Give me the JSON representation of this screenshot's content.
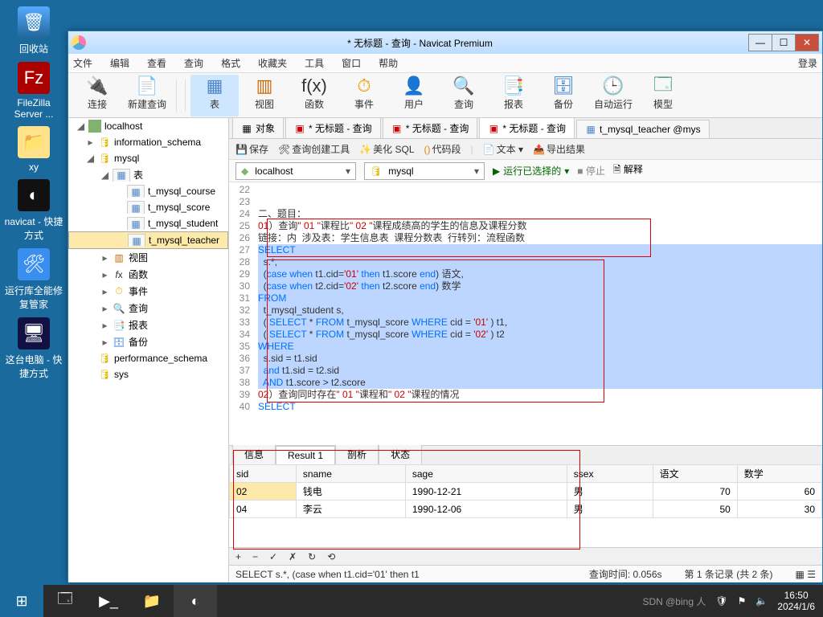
{
  "desktop": {
    "icons": [
      "回收站",
      "FileZilla Server ...",
      "xy",
      "navicat - 快捷方式",
      "运行库全能修复管家",
      "这台电脑 - 快捷方式"
    ]
  },
  "win": {
    "title": "* 无标题 - 查询 - Navicat Premium",
    "menus": [
      "文件",
      "编辑",
      "查看",
      "查询",
      "格式",
      "收藏夹",
      "工具",
      "窗口",
      "帮助"
    ],
    "login": "登录",
    "toolbar": [
      {
        "lbl": "连接",
        "cls": "plug",
        "glyph": "🔌"
      },
      {
        "lbl": "新建查询",
        "cls": "new",
        "glyph": "📄"
      },
      {
        "lbl": "表",
        "cls": "table",
        "glyph": "▦",
        "act": true
      },
      {
        "lbl": "视图",
        "cls": "view",
        "glyph": "▥"
      },
      {
        "lbl": "函数",
        "cls": "fx",
        "glyph": "f(x)"
      },
      {
        "lbl": "事件",
        "cls": "ev",
        "glyph": "⏱"
      },
      {
        "lbl": "用户",
        "cls": "usr",
        "glyph": "👤"
      },
      {
        "lbl": "查询",
        "cls": "find",
        "glyph": "🔍"
      },
      {
        "lbl": "报表",
        "cls": "rep",
        "glyph": "📑"
      },
      {
        "lbl": "备份",
        "cls": "bak",
        "glyph": "🗄"
      },
      {
        "lbl": "自动运行",
        "cls": "auto",
        "glyph": "🕒"
      },
      {
        "lbl": "模型",
        "cls": "model",
        "glyph": "🗔"
      }
    ],
    "tree": {
      "root": "localhost",
      "dbs": [
        "information_schema",
        "mysql"
      ],
      "tables": [
        "t_mysql_course",
        "t_mysql_score",
        "t_mysql_student",
        "t_mysql_teacher"
      ],
      "folders": {
        "table": "表",
        "view": "视图",
        "fx": "函数",
        "event": "事件",
        "query": "查询",
        "report": "报表",
        "backup": "备份"
      },
      "other_dbs": [
        "performance_schema",
        "sys"
      ]
    },
    "tabs": {
      "obj": "对象",
      "t1": "* 无标题 - 查询",
      "t2": "* 无标题 - 查询",
      "t3": "* 无标题 - 查询",
      "t4": "t_mysql_teacher @mys"
    },
    "subbar": {
      "save": "保存",
      "qb": "查询创建工具",
      "beautify": "美化 SQL",
      "cfold": "代码段",
      "text": "文本",
      "export": "导出结果"
    },
    "connbar": {
      "conn": "localhost",
      "db": "mysql",
      "run": "运行已选择的",
      "stop": "停止",
      "explain": "解释"
    },
    "code": {
      "lines": [
        {
          "n": 22,
          "t": ""
        },
        {
          "n": 23,
          "t": ""
        },
        {
          "n": 24,
          "t": "二、题目："
        },
        {
          "n": 25,
          "p": [
            [
              "01",
              "red"
            ],
            [
              "）查询",
              ""
            ],
            [
              "\" 01 \"",
              "str"
            ],
            [
              "课程比",
              ""
            ],
            [
              "\" 02 \"",
              "str"
            ],
            [
              "课程成绩高的学生的信息及课程分数",
              ""
            ]
          ]
        },
        {
          "n": 26,
          "t": "链接：内  涉及表：学生信息表  课程分数表  行转列：流程函数"
        },
        {
          "n": 27,
          "hl": true,
          "p": [
            [
              "SELECT",
              "kw"
            ]
          ]
        },
        {
          "n": 28,
          "hl": true,
          "t": "  s.*,"
        },
        {
          "n": 29,
          "hl": true,
          "p": [
            [
              "  (",
              ""
            ],
            [
              "case when",
              "kw"
            ],
            [
              " t1.cid=",
              ""
            ],
            [
              "'01'",
              "str"
            ],
            [
              " ",
              ""
            ],
            [
              "then",
              "kw"
            ],
            [
              " t1.score ",
              ""
            ],
            [
              "end",
              "kw"
            ],
            [
              ") 语文,",
              ""
            ]
          ]
        },
        {
          "n": 30,
          "hl": true,
          "p": [
            [
              "  (",
              ""
            ],
            [
              "case when",
              "kw"
            ],
            [
              " t2.cid=",
              ""
            ],
            [
              "'02'",
              "str"
            ],
            [
              " ",
              ""
            ],
            [
              "then",
              "kw"
            ],
            [
              " t2.score ",
              ""
            ],
            [
              "end",
              "kw"
            ],
            [
              ") 数学",
              ""
            ]
          ]
        },
        {
          "n": 31,
          "hl": true,
          "p": [
            [
              "FROM",
              "kw"
            ]
          ]
        },
        {
          "n": 32,
          "hl": true,
          "t": "  t_mysql_student s,"
        },
        {
          "n": 33,
          "hl": true,
          "p": [
            [
              "  ( ",
              ""
            ],
            [
              "SELECT",
              "kw"
            ],
            [
              " * ",
              ""
            ],
            [
              "FROM",
              "kw"
            ],
            [
              " t_mysql_score ",
              ""
            ],
            [
              "WHERE",
              "kw"
            ],
            [
              " cid = ",
              ""
            ],
            [
              "'01'",
              "str"
            ],
            [
              " ) t1,",
              ""
            ]
          ]
        },
        {
          "n": 34,
          "hl": true,
          "p": [
            [
              "  ( ",
              ""
            ],
            [
              "SELECT",
              "kw"
            ],
            [
              " * ",
              ""
            ],
            [
              "FROM",
              "kw"
            ],
            [
              " t_mysql_score ",
              ""
            ],
            [
              "WHERE",
              "kw"
            ],
            [
              " cid = ",
              ""
            ],
            [
              "'02'",
              "str"
            ],
            [
              " ) t2",
              ""
            ]
          ]
        },
        {
          "n": 35,
          "hl": true,
          "p": [
            [
              "WHERE",
              "kw"
            ]
          ]
        },
        {
          "n": 36,
          "hl": true,
          "t": "  s.sid = t1.sid"
        },
        {
          "n": 37,
          "hl": true,
          "p": [
            [
              "  ",
              ""
            ],
            [
              "and",
              "kw"
            ],
            [
              " t1.sid = t2.sid",
              ""
            ]
          ]
        },
        {
          "n": 38,
          "hl": true,
          "p": [
            [
              "  ",
              ""
            ],
            [
              "AND",
              "kw"
            ],
            [
              " t1.score > t2.score",
              ""
            ]
          ]
        },
        {
          "n": 39,
          "p": [
            [
              "02",
              "red"
            ],
            [
              "）查询同时存在",
              ""
            ],
            [
              "\" 01 \"",
              "str"
            ],
            [
              "课程和",
              ""
            ],
            [
              "\" 02 \"",
              "str"
            ],
            [
              "课程的情况",
              ""
            ]
          ]
        },
        {
          "n": 40,
          "p": [
            [
              "SELECT",
              "kw"
            ]
          ]
        }
      ]
    },
    "rtabs": [
      "信息",
      "Result 1",
      "剖析",
      "状态"
    ],
    "grid": {
      "cols": [
        "sid",
        "sname",
        "sage",
        "ssex",
        "语文",
        "数学"
      ],
      "rows": [
        [
          "02",
          "钱电",
          "1990-12-21",
          "男",
          "70",
          "60"
        ],
        [
          "04",
          "李云",
          "1990-12-06",
          "男",
          "50",
          "30"
        ]
      ]
    },
    "gridctrl": [
      "+",
      "−",
      "✓",
      "✗",
      "↻",
      "⟲"
    ],
    "status": {
      "sql": "SELECT   s.*,   (case when t1.cid='01' then t1",
      "time": "查询时间: 0.056s",
      "rec": "第 1 条记录 (共 2 条)"
    }
  },
  "taskbar": {
    "time": "16:50",
    "date": "2024/1/6",
    "wm": "SDN @bing 人"
  }
}
